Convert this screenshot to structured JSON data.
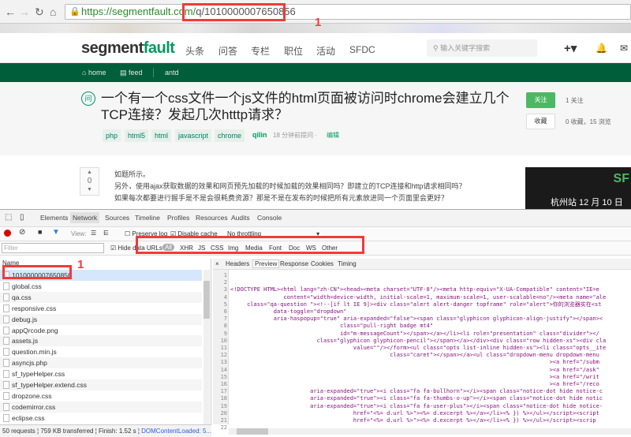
{
  "browser": {
    "url_scheme": "https://",
    "url_host": "segmentfault.com/",
    "url_path": "q/1010000007650856"
  },
  "site": {
    "logo_a": "segment",
    "logo_b": "fault",
    "nav": [
      "头条",
      "问答",
      "专栏",
      "职位",
      "活动",
      "SFDC"
    ],
    "search_placeholder": "输入关键字搜索",
    "sub_nav": {
      "home": "home",
      "feed": "feed",
      "tag": "antd"
    }
  },
  "question": {
    "icon": "问",
    "title": "一个有一个css文件一个js文件的html页面被访问时chrome会建立几个TCP连接？发起几次htttp请求？",
    "tags": [
      "php",
      "html5",
      "html",
      "javascript",
      "chrome"
    ],
    "author": "qilin",
    "time": "18 分钟前提问 ·",
    "edit": "编辑",
    "follow_label": "关注",
    "follow_count": "1 关注",
    "fav_label": "收藏",
    "stats": "0 收藏，15 浏览",
    "votes": "0",
    "body": [
      "如题所示。",
      "另外，使用ajax获取数据的效果和网页预先加载的时候加载的效果相同吗？即建立的TCP连接和http请求相同吗？",
      "如果每次都要进行握手是不是会很耗费资源？那是不是在发布的时候把所有元素放进同一个页面里会更好？"
    ],
    "ad_title": "SF",
    "ad_text": "杭州站 12 月 10 日"
  },
  "devtools": {
    "tabs": [
      "Elements",
      "Network",
      "Sources",
      "Timeline",
      "Profiles",
      "Resources",
      "Audits",
      "Console"
    ],
    "view_label": "View:",
    "preserve_log": "Preserve log",
    "disable_cache": "Disable cache",
    "throttling": "No throttling",
    "filter_placeholder": "Filter",
    "hide_data_urls": "Hide data URLs",
    "types": [
      "All",
      "XHR",
      "JS",
      "CSS",
      "Img",
      "Media",
      "Font",
      "Doc",
      "WS",
      "Other"
    ],
    "name_header": "Name",
    "files": [
      "1010000007650856",
      "global.css",
      "qa.css",
      "responsive.css",
      "debug.js",
      "appQrcode.png",
      "assets.js",
      "question.min.js",
      "asyncjs.php",
      "sf_typeHelper.css",
      "sf_typeHelper.extend.css",
      "dropzone.css",
      "codemirror.css",
      "eclipse.css"
    ],
    "detail_tabs": [
      "Headers",
      "Preview",
      "Response",
      "Cookies",
      "Timing"
    ],
    "code": [
      "",
      "",
      "<!DOCTYPE HTML><html lang=\"zh-CN\"><head><meta charset=\"UTF-8\"/><meta http-equiv=\"X-UA-Compatible\" content=\"IE=e",
      "                content=\"width=device-width, initial-scale=1, maximum-scale=1, user-scalable=no\"/><meta name=\"ale",
      "     class=\"qa-question \"><!--[if lt IE 9]><div class=\"alert alert-danger topframe\" role=\"alert\">你的浏览器实在<st",
      "             data-toggle=\"dropdown\"",
      "             aria-haspopup=\"true\" aria-expanded=\"false\"><span class=\"glyphicon glyphicon-align-justify\"></span><",
      "                                 class=\"pull-right badge mt4\"",
      "                                 id=\"m-messageCount\"></span></a></li><li role=\"presentation\" class=\"divider\"></",
      "                          class=\"glyphicon glyphicon-pencil\"></span></a></div><div class=\"row hidden-xs\"><div cla",
      "                                     value=\"\"/></form><ul class=\"opts list-inline hidden-xs\"><li class=\"opts__ite",
      "                                                class=\"caret\"></span></a><ul class=\"dropdown-menu dropdown-menu",
      "                                                                                                ><a href=\"/subm",
      "                                                                                                ><a href=\"/ask\"",
      "                                                                                                ><a href=\"/writ",
      "                                                                                                ><a href=\"/reco",
      "                        aria-expanded=\"true\"><i class=\"fa fa-bullhorn\"></i><span class=\"notice-dot hide notice-c",
      "                        aria-expanded=\"true\"><i class=\"fa fa-thumbs-o-up\"></i><span class=\"notice-dot hide notic",
      "                        aria-expanded=\"true\"><i class=\"fa fa-user-plus\"></i><span class=\"notice-dot hide notice-",
      "                                     href=\"<%= d.url %>\"><%= d.excerpt %></a></li><% }) %></ul></script><script",
      "                                     href=\"<%= d.url %>\"><%= d.excerpt %></a></li><% }) %></ul></script><scrip",
      ""
    ],
    "status": {
      "requests": "50 requests",
      "transferred": "759 KB transferred",
      "finish": "Finish: 1.52 s",
      "dcl": "DOMContentLoaded: 5..."
    }
  },
  "annotations": {
    "marker": "1"
  },
  "colors": {
    "brand": "#009a61",
    "navbar": "#005f3b",
    "annotation": "#f23a3a"
  }
}
